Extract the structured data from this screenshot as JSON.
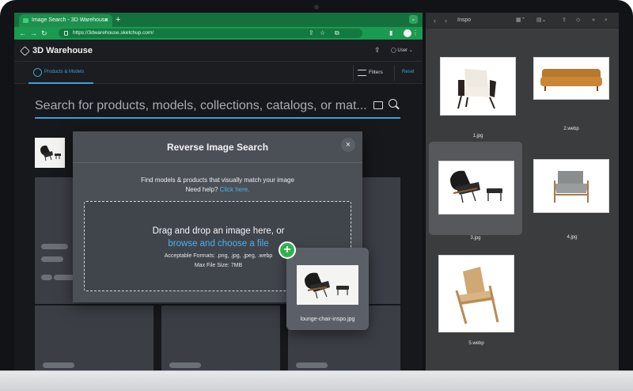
{
  "browser": {
    "tab_title": "Image Search - 3D Warehouse",
    "tab_close": "×",
    "new_tab": "+",
    "url": "https://3dwarehouse.sketchup.com/"
  },
  "site": {
    "logo_text": "3D Warehouse",
    "user_label": "User",
    "products_tab": "Products & Models",
    "filters_label": "Filters",
    "reset_label": "Reset",
    "search_placeholder": "Search for products, models, collections, catalogs, or mat..."
  },
  "modal": {
    "title": "Reverse Image Search",
    "close": "×",
    "description": "Find models & products that visually match your image",
    "help_prefix": "Need help?",
    "help_link": "Click here.",
    "drop_text": "Drag and drop an image here, or",
    "browse_link": "browse and choose a file",
    "formats": "Acceptable Formats: .png, .jpg, .jpeg, .webp",
    "max_size": "Max File Size: 7MB"
  },
  "drag": {
    "filename": "lounge-chair-inspo.jpg",
    "plus": "+"
  },
  "finder": {
    "folder": "Inspo",
    "files": [
      {
        "name": "1.jpg"
      },
      {
        "name": "2.webp"
      },
      {
        "name": "3.jpg",
        "selected": true
      },
      {
        "name": "4.jpg"
      },
      {
        "name": "5.webp"
      }
    ]
  },
  "colors": {
    "accent_blue": "#47b3ea",
    "browser_green": "#1c9a52",
    "add_green": "#2fb24c"
  }
}
